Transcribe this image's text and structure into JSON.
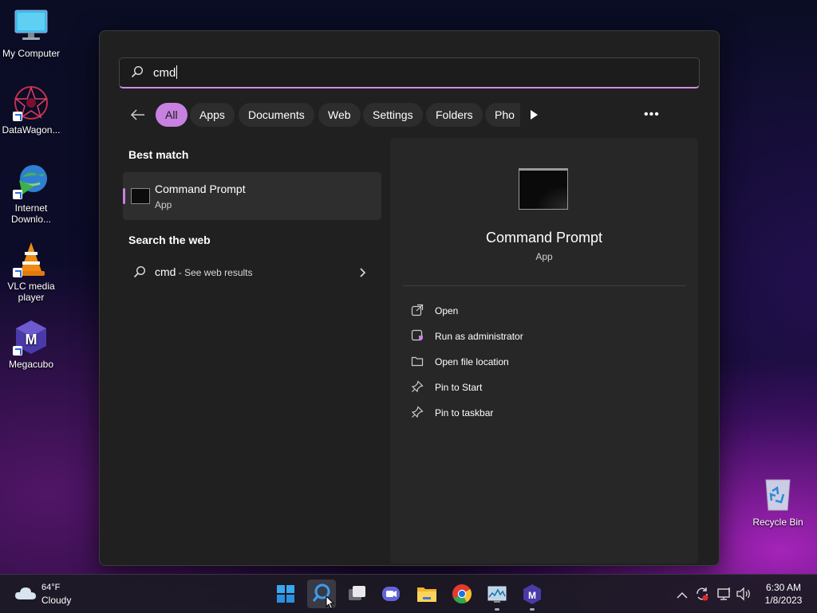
{
  "desktop": {
    "icons": [
      {
        "name": "my-computer",
        "label": "My Computer"
      },
      {
        "name": "datawagon",
        "label": "DataWagon..."
      },
      {
        "name": "internet-download",
        "label": "Internet Downlo..."
      },
      {
        "name": "vlc",
        "label": "VLC media player"
      },
      {
        "name": "megacubo",
        "label": "Megacubo"
      },
      {
        "name": "recycle-bin",
        "label": "Recycle Bin"
      }
    ]
  },
  "search": {
    "query": "cmd"
  },
  "filters": [
    "All",
    "Apps",
    "Documents",
    "Web",
    "Settings",
    "Folders",
    "Pho"
  ],
  "results": {
    "best_match_title": "Best match",
    "best_match": {
      "name": "Command Prompt",
      "type": "App"
    },
    "web_title": "Search the web",
    "web_item": {
      "query": "cmd",
      "suffix": " - See web results"
    }
  },
  "detail": {
    "name": "Command Prompt",
    "type": "App",
    "actions": [
      "Open",
      "Run as administrator",
      "Open file location",
      "Pin to Start",
      "Pin to taskbar"
    ]
  },
  "weather": {
    "temp": "64°F",
    "condition": "Cloudy"
  },
  "clock": {
    "time": "6:30 AM",
    "date": "1/8/2023"
  },
  "colors": {
    "accent": "#c881e0",
    "panel": "#202020"
  }
}
